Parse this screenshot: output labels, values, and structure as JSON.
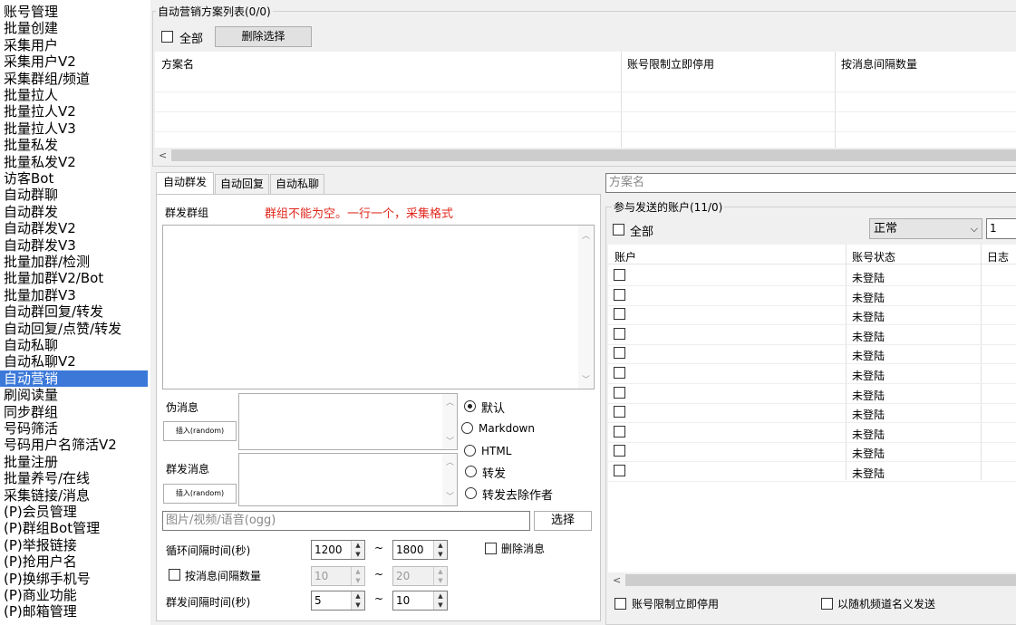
{
  "sidebar": {
    "items": [
      "账号管理",
      "批量创建",
      "采集用户",
      "采集用户V2",
      "采集群组/频道",
      "批量拉人",
      "批量拉人V2",
      "批量拉人V3",
      "批量私发",
      "批量私发V2",
      "访客Bot",
      "自动群聊",
      "自动群发",
      "自动群发V2",
      "自动群发V3",
      "批量加群/检测",
      "批量加群V2/Bot",
      "批量加群V3",
      "自动群回复/转发",
      "自动回复/点赞/转发",
      "自动私聊",
      "自动私聊V2",
      "自动营销",
      "刷阅读量",
      "同步群组",
      "号码筛活",
      "号码用户名筛活V2",
      "批量注册",
      "批量养号/在线",
      "采集链接/消息",
      "(P)会员管理",
      "(P)群组Bot管理",
      "(P)举报链接",
      "(P)抢用户名",
      "(P)换绑手机号",
      "(P)商业功能",
      "(P)邮箱管理"
    ],
    "selected": "自动营销"
  },
  "plan_list": {
    "title": "自动营销方案列表(0/0)",
    "all_label": "全部",
    "delete_button": "删除选择",
    "columns": [
      "方案名",
      "账号限制立即停用",
      "按消息间隔数量"
    ]
  },
  "tabs": [
    "自动群发",
    "自动回复",
    "自动私聊"
  ],
  "broadcast": {
    "group_label": "群发群组",
    "group_hint": "群组不能为空。一行一个，采集格式",
    "fake_msg_label": "伪消息",
    "insert_random": "插入(random)",
    "broadcast_msg_label": "群发消息",
    "media_placeholder": "图片/视频/语音(ogg)",
    "choose_button": "选择",
    "radio_options": [
      "默认",
      "Markdown",
      "HTML",
      "转发",
      "转发去除作者"
    ],
    "radio_selected": "默认",
    "loop_interval_label": "循环间隔时间(秒)",
    "loop_min": "1200",
    "loop_max": "1800",
    "delete_msg_label": "删除消息",
    "by_msg_interval_label": "按消息间隔数量",
    "msg_interval_min": "10",
    "msg_interval_max": "20",
    "send_interval_label": "群发间隔时间(秒)",
    "send_min": "5",
    "send_max": "10",
    "tilde": "~"
  },
  "accounts": {
    "plan_name_placeholder": "方案名",
    "title": "参与发送的账户(11/0)",
    "all_label": "全部",
    "status_filter": "正常",
    "count_input": "1",
    "columns": [
      "账户",
      "账号状态",
      "日志"
    ],
    "rows": [
      "未登陆",
      "未登陆",
      "未登陆",
      "未登陆",
      "未登陆",
      "未登陆",
      "未登陆",
      "未登陆",
      "未登陆",
      "未登陆",
      "未登陆"
    ],
    "limit_stop_label": "账号限制立即停用",
    "random_channel_label": "以随机频道名义发送"
  }
}
